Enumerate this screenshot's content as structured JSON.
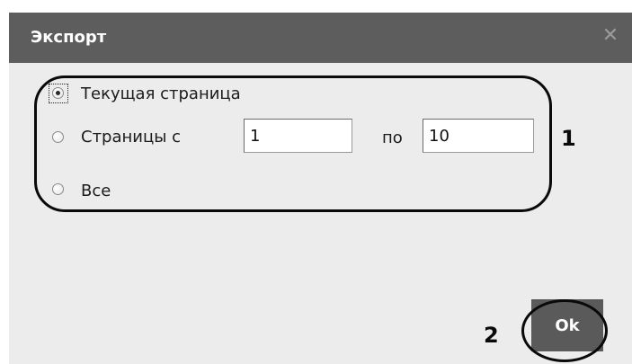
{
  "dialog": {
    "title": "Экспорт",
    "close_icon": "close-icon"
  },
  "options": {
    "current_page_label": "Текущая страница",
    "pages_label": "Страницы с",
    "pages_to_label": "по",
    "pages_from_value": "1",
    "pages_to_value": "10",
    "all_label": "Все",
    "selected": "current_page"
  },
  "annotations": {
    "group_number": "1",
    "ok_number": "2"
  },
  "buttons": {
    "ok_label": "Ok"
  }
}
